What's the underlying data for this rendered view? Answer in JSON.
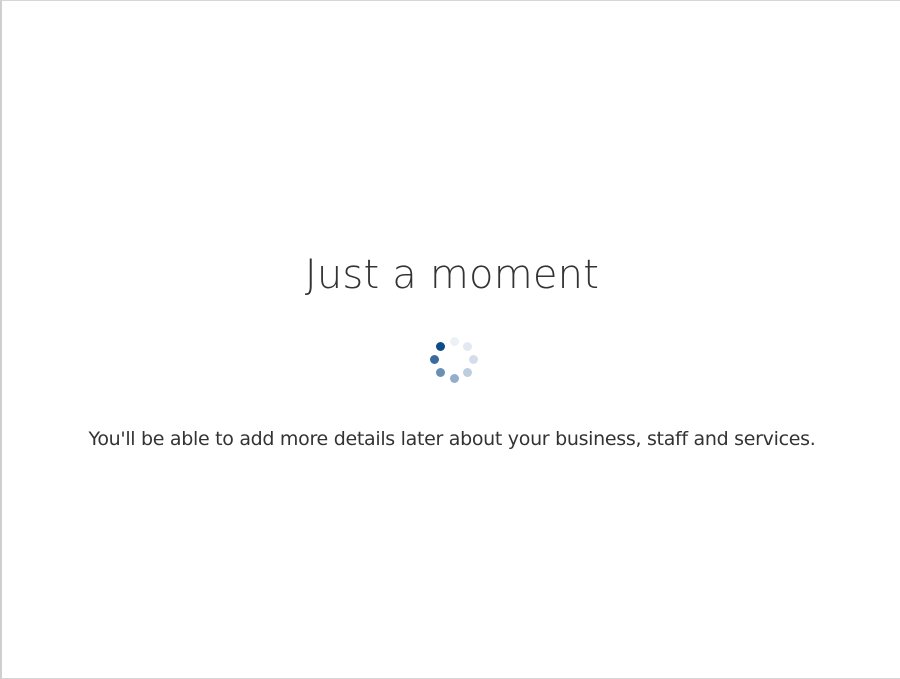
{
  "loading": {
    "title": "Just a moment",
    "message": "You'll be able to add more details later about your business, staff and services.",
    "spinner_icon": "loading-spinner-icon",
    "spinner_color": "#0f4a8a"
  }
}
